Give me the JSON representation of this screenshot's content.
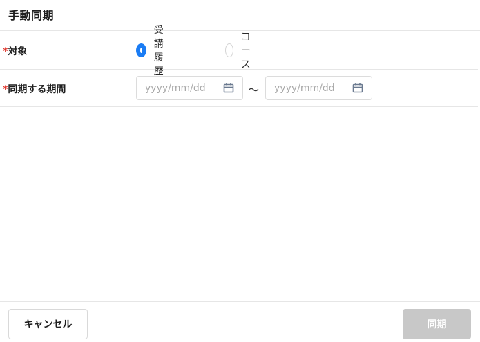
{
  "dialog": {
    "title": "手動同期"
  },
  "target": {
    "required_mark": "*",
    "label": "対象",
    "options": [
      {
        "label": "受講履歴",
        "checked": true
      },
      {
        "label": "コース",
        "checked": false
      }
    ]
  },
  "period": {
    "required_mark": "*",
    "label": "同期する期間",
    "from_placeholder": "yyyy/mm/dd",
    "to_placeholder": "yyyy/mm/dd",
    "separator": "〜",
    "icon": "calendar-icon"
  },
  "footer": {
    "cancel_label": "キャンセル",
    "sync_label": "同期",
    "sync_disabled": true
  },
  "colors": {
    "accent": "#1a7cf4",
    "required": "#e0352b",
    "disabled_button": "#c8c8c8",
    "icon": "#6b7a90"
  }
}
